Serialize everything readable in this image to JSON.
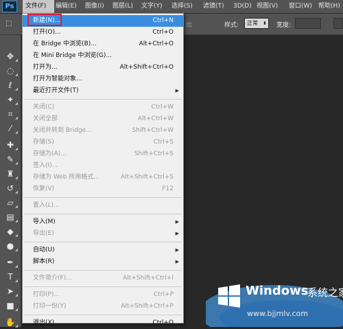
{
  "app": {
    "logo": "Ps"
  },
  "menubar": {
    "items": [
      {
        "label": "文件(F)",
        "active": true
      },
      {
        "label": "编辑(E)"
      },
      {
        "label": "图像(I)"
      },
      {
        "label": "图层(L)"
      },
      {
        "label": "文字(Y)"
      },
      {
        "label": "选择(S)"
      },
      {
        "label": "滤镜(T)"
      },
      {
        "label": "3D(D)"
      },
      {
        "label": "视图(V)"
      },
      {
        "label": "窗口(W)"
      },
      {
        "label": "帮助(H)"
      }
    ]
  },
  "options": {
    "faded_text": "出",
    "style_label": "样式:",
    "style_value": "正常",
    "width_label": "宽度:"
  },
  "file_menu": {
    "items": [
      {
        "label": "新建(N)...",
        "shortcut": "Ctrl+N",
        "state": "highlight"
      },
      {
        "label": "打开(O)...",
        "shortcut": "Ctrl+O"
      },
      {
        "label": "在 Bridge 中浏览(B)...",
        "shortcut": "Alt+Ctrl+O"
      },
      {
        "label": "在 Mini Bridge 中浏览(G)..."
      },
      {
        "label": "打开为...",
        "shortcut": "Alt+Shift+Ctrl+O"
      },
      {
        "label": "打开为智能对象..."
      },
      {
        "label": "最近打开文件(T)",
        "submenu": true
      },
      {
        "sep": true
      },
      {
        "label": "关闭(C)",
        "shortcut": "Ctrl+W",
        "state": "disabled"
      },
      {
        "label": "关闭全部",
        "shortcut": "Alt+Ctrl+W",
        "state": "disabled"
      },
      {
        "label": "关闭并转到 Bridge...",
        "shortcut": "Shift+Ctrl+W",
        "state": "disabled"
      },
      {
        "label": "存储(S)",
        "shortcut": "Ctrl+S",
        "state": "disabled"
      },
      {
        "label": "存储为(A)...",
        "shortcut": "Shift+Ctrl+S",
        "state": "disabled"
      },
      {
        "label": "签入(I)...",
        "state": "disabled"
      },
      {
        "label": "存储为 Web 所用格式...",
        "shortcut": "Alt+Shift+Ctrl+S",
        "state": "disabled"
      },
      {
        "label": "恢复(V)",
        "shortcut": "F12",
        "state": "disabled"
      },
      {
        "sep": true
      },
      {
        "label": "置入(L)...",
        "state": "disabled"
      },
      {
        "sep": true
      },
      {
        "label": "导入(M)",
        "submenu": true
      },
      {
        "label": "导出(E)",
        "submenu": true,
        "state": "disabled"
      },
      {
        "sep": true
      },
      {
        "label": "自动(U)",
        "submenu": true
      },
      {
        "label": "脚本(R)",
        "submenu": true
      },
      {
        "sep": true
      },
      {
        "label": "文件简介(F)...",
        "shortcut": "Alt+Shift+Ctrl+I",
        "state": "disabled"
      },
      {
        "sep": true
      },
      {
        "label": "打印(P)...",
        "shortcut": "Ctrl+P",
        "state": "disabled"
      },
      {
        "label": "打印一份(Y)",
        "shortcut": "Alt+Shift+Ctrl+P",
        "state": "disabled"
      },
      {
        "sep": true
      },
      {
        "label": "退出(X)",
        "shortcut": "Ctrl+Q"
      }
    ]
  },
  "tools": [
    {
      "icon": "move-icon",
      "glyph": "✥"
    },
    {
      "icon": "marquee-icon",
      "glyph": "◌"
    },
    {
      "icon": "lasso-icon",
      "glyph": "ℓ"
    },
    {
      "icon": "magic-wand-icon",
      "glyph": "✦"
    },
    {
      "icon": "crop-icon",
      "glyph": "⌗"
    },
    {
      "icon": "eyedropper-icon",
      "glyph": "⁄"
    },
    {
      "icon": "healing-brush-icon",
      "glyph": "✚"
    },
    {
      "icon": "brush-icon",
      "glyph": "✎"
    },
    {
      "icon": "clone-stamp-icon",
      "glyph": "♜"
    },
    {
      "icon": "history-brush-icon",
      "glyph": "↺"
    },
    {
      "icon": "eraser-icon",
      "glyph": "▱"
    },
    {
      "icon": "gradient-icon",
      "glyph": "▤"
    },
    {
      "icon": "blur-icon",
      "glyph": "◆"
    },
    {
      "icon": "dodge-icon",
      "glyph": "●"
    },
    {
      "icon": "pen-icon",
      "glyph": "✒"
    },
    {
      "icon": "type-icon",
      "glyph": "T"
    },
    {
      "icon": "path-selection-icon",
      "glyph": "➤"
    },
    {
      "icon": "shape-icon",
      "glyph": "■"
    },
    {
      "icon": "hand-icon",
      "glyph": "✋"
    }
  ],
  "watermark": {
    "brand": "Windows",
    "cn": "系统之家",
    "url": "www.bjjmlv.com"
  }
}
